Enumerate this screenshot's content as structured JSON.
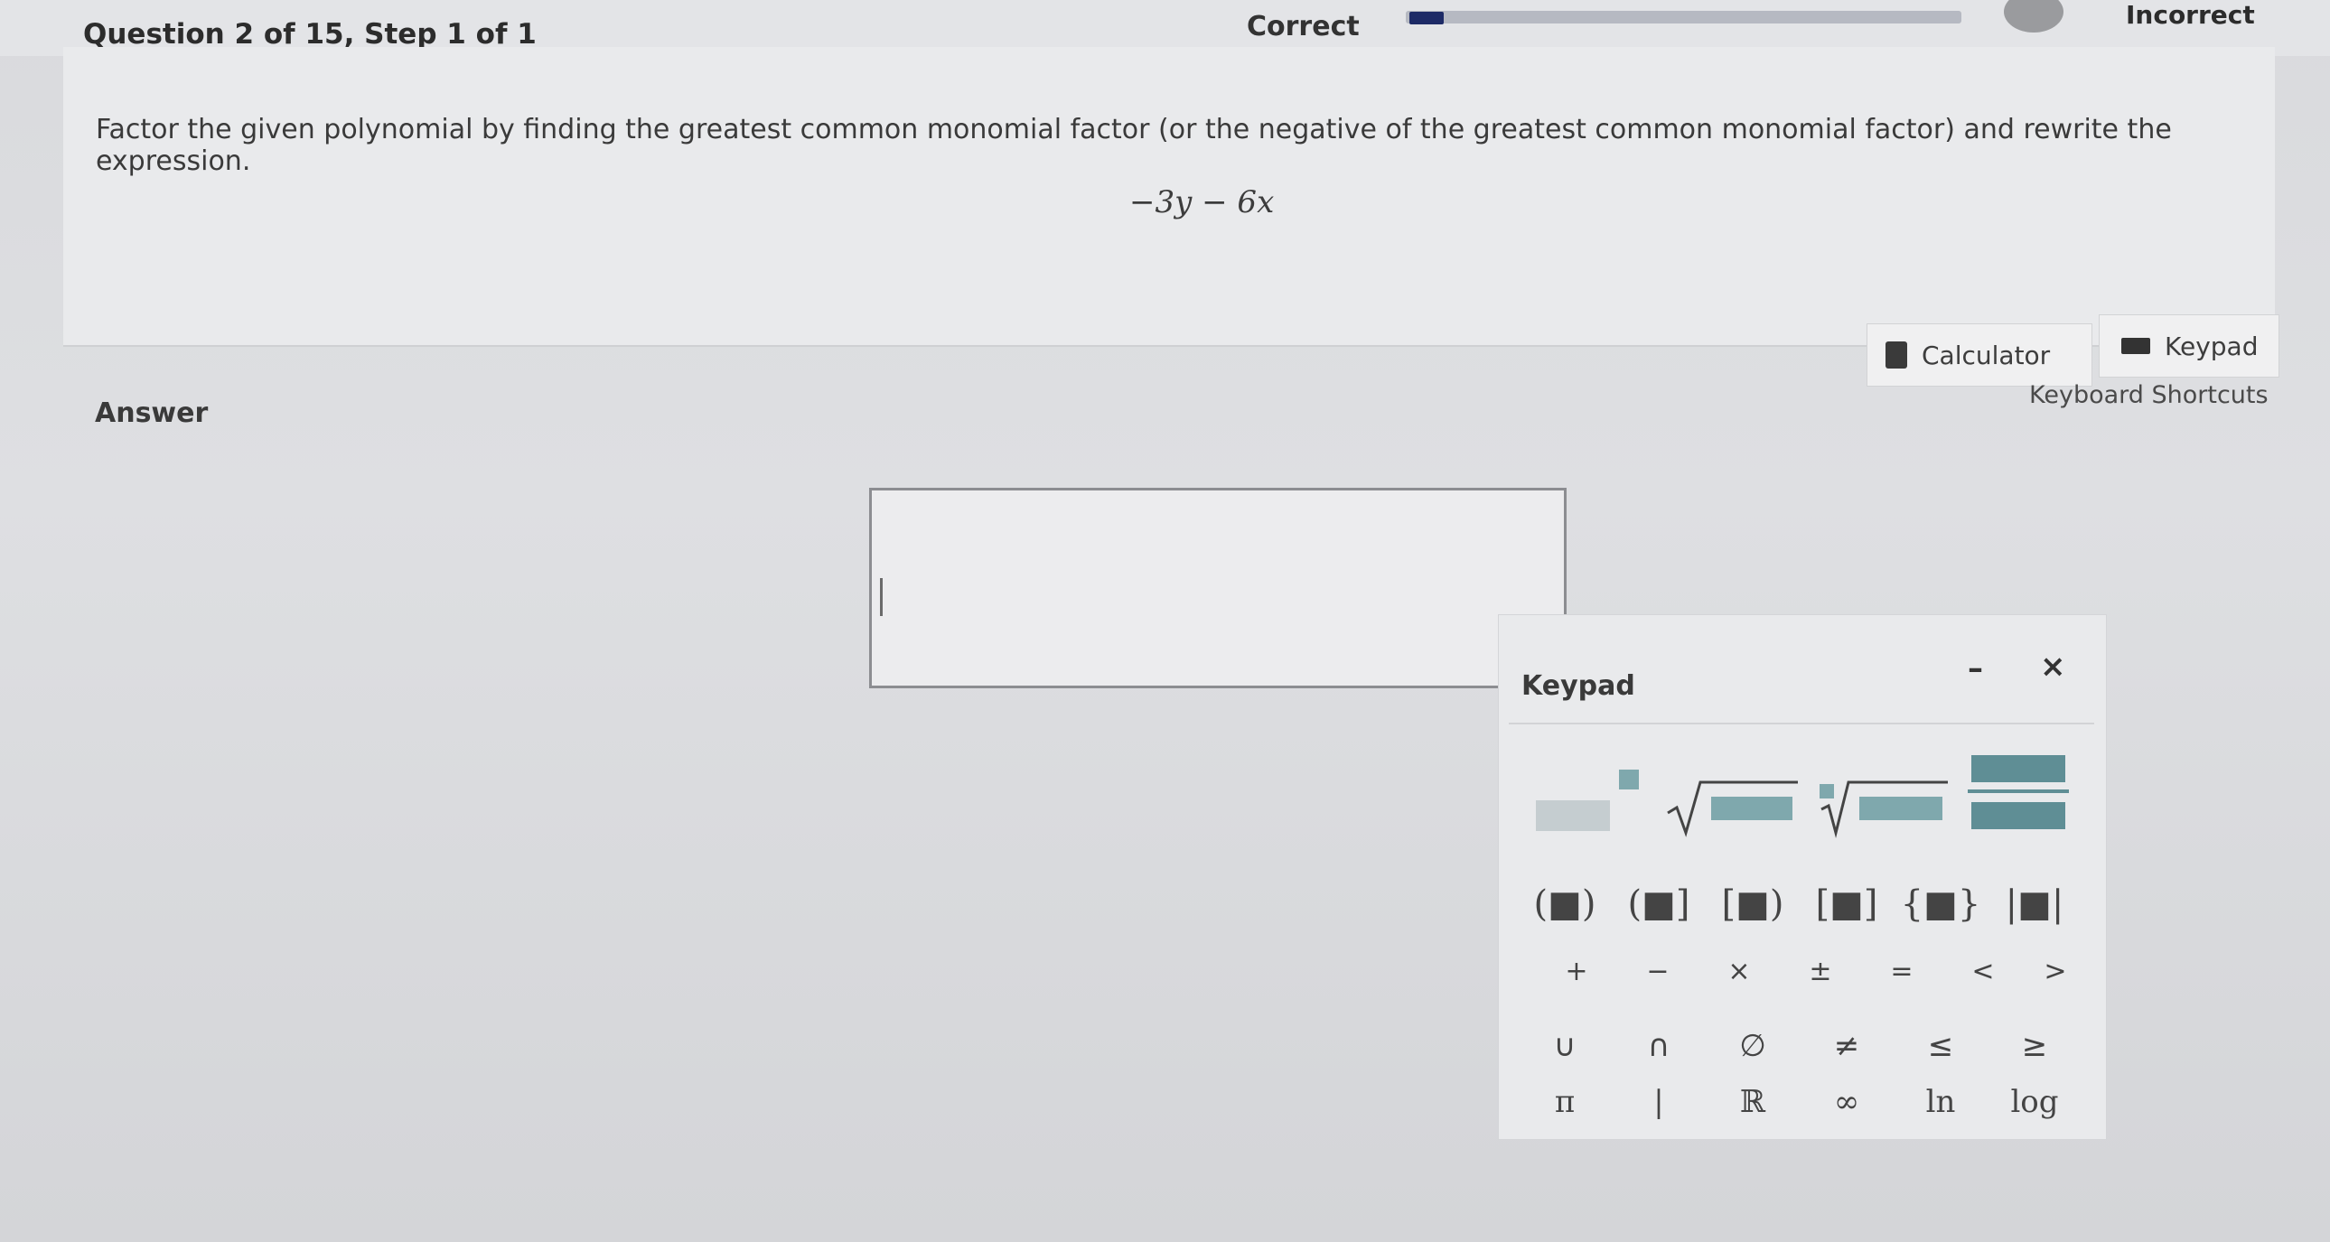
{
  "header": {
    "question_label": "Question 2 of 15,  Step 1 of 1",
    "correct_label": "Correct",
    "incorrect_label": "Incorrect",
    "progress_fraction": 0.06
  },
  "question": {
    "prompt": "Factor the given polynomial by finding the greatest common monomial factor (or the negative of the greatest common monomial factor) and rewrite the expression.",
    "expression": "−3y − 6x"
  },
  "tools": {
    "calculator_label": "Calculator",
    "keypad_label": "Keypad",
    "shortcuts_label": "Keyboard Shortcuts"
  },
  "answer": {
    "label": "Answer",
    "value": ""
  },
  "keypad": {
    "title": "Keypad",
    "minimize": "–",
    "close": "×",
    "templates": [
      "exponent-template",
      "square-root-template",
      "nth-root-template",
      "fraction-template"
    ],
    "brackets": [
      "(■)",
      "(■]",
      "[■)",
      "[■]",
      "{■}",
      "|■|"
    ],
    "operators": [
      "+",
      "−",
      "×",
      "±",
      "=",
      "<",
      ">"
    ],
    "sets": [
      "∪",
      "∩",
      "∅",
      "≠",
      "≤",
      "≥"
    ],
    "constants": [
      "π",
      "|",
      "ℝ",
      "∞",
      "ln",
      "log"
    ]
  },
  "colors": {
    "accent": "#5f8e95",
    "progress": "#1d2a66"
  }
}
